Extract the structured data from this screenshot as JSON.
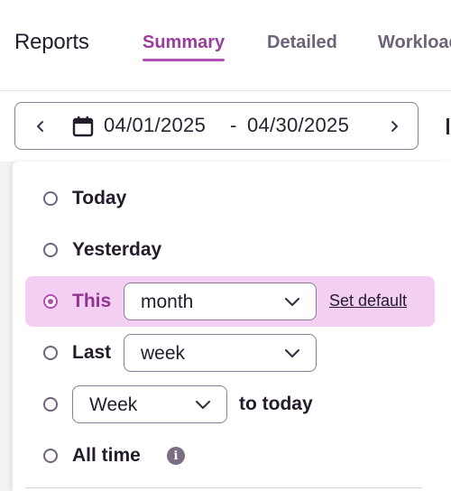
{
  "header": {
    "title": "Reports",
    "tabs": [
      {
        "label": "Summary",
        "active": true
      },
      {
        "label": "Detailed",
        "active": false
      },
      {
        "label": "Workload",
        "active": false
      }
    ]
  },
  "date_range": {
    "start": "04/01/2025",
    "separator": "-",
    "end": "04/30/2025",
    "icons": [
      "chevron-left-icon",
      "calendar-icon",
      "chevron-right-icon"
    ]
  },
  "period_options": {
    "today": {
      "label": "Today",
      "selected": false
    },
    "yesterday": {
      "label": "Yesterday",
      "selected": false
    },
    "this": {
      "label": "This",
      "selected": true,
      "unit": "month",
      "action": "Set default"
    },
    "last": {
      "label": "Last",
      "selected": false,
      "unit": "week"
    },
    "to_today": {
      "selected": false,
      "unit": "Week",
      "suffix": "to today"
    },
    "all_time": {
      "label": "All time",
      "selected": false,
      "info_icon": "info-icon"
    }
  },
  "colors": {
    "accent": "#b24fb4",
    "selected_row_bg": "#f4cff4",
    "text": "#241b2b"
  }
}
